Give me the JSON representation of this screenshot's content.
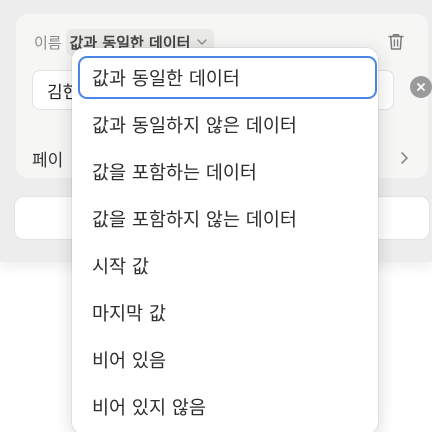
{
  "filter": {
    "property_label": "이름",
    "condition_label": "값과 동일한 데이터",
    "value_text": "김현",
    "page_row_label": "페이"
  },
  "dropdown": {
    "items": [
      {
        "label": "값과 동일한 데이터",
        "selected": true
      },
      {
        "label": "값과 동일하지 않은 데이터",
        "selected": false
      },
      {
        "label": "값을 포함하는 데이터",
        "selected": false
      },
      {
        "label": "값을 포함하지 않는 데이터",
        "selected": false
      },
      {
        "label": "시작 값",
        "selected": false
      },
      {
        "label": "마지막 값",
        "selected": false
      },
      {
        "label": "비어 있음",
        "selected": false
      },
      {
        "label": "비어 있지 않음",
        "selected": false
      }
    ]
  },
  "colors": {
    "selection_border": "#4a86e6",
    "card_background": "#f6f6f5",
    "chip_background": "#e9e9e7"
  },
  "icons": {
    "condition_chevron": "chevron-down-icon",
    "delete": "trash-icon",
    "clear": "clear-icon",
    "page_chevron": "chevron-right-icon"
  }
}
